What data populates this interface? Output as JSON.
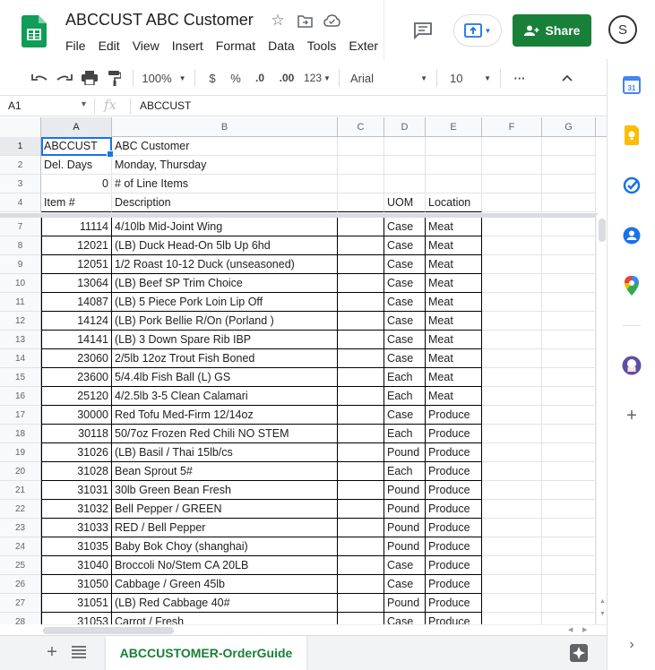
{
  "header": {
    "title": "ABCCUST ABC Customer",
    "menu": [
      "File",
      "Edit",
      "View",
      "Insert",
      "Format",
      "Data",
      "Tools",
      "Exter"
    ],
    "share_label": "Share",
    "avatar_letter": "S"
  },
  "toolbar": {
    "zoom": "100%",
    "currency": "$",
    "percent": "%",
    "decrease_decimal": ".0",
    "increase_decimal": ".00",
    "number_format": "123",
    "font": "Arial",
    "font_size": "10",
    "more": "···"
  },
  "formula_bar": {
    "cell_ref": "A1",
    "fx": "fx",
    "value": "ABCCUST"
  },
  "columns": [
    "A",
    "B",
    "C",
    "D",
    "E",
    "F",
    "G"
  ],
  "top_rows": [
    {
      "num": "1",
      "a": "ABCCUST",
      "b": "ABC Customer",
      "d": "",
      "e": ""
    },
    {
      "num": "2",
      "a": "Del. Days",
      "b": "Monday, Thursday",
      "d": "",
      "e": ""
    },
    {
      "num": "3",
      "a": "0",
      "b": "# of Line Items",
      "d": "",
      "e": ""
    },
    {
      "num": "4",
      "a": "Item #",
      "b": "Description",
      "d": "UOM",
      "e": "Location"
    }
  ],
  "rows": [
    {
      "num": "7",
      "a": "11114",
      "b": "4/10lb Mid-Joint Wing",
      "d": "Case",
      "e": "Meat"
    },
    {
      "num": "8",
      "a": "12021",
      "b": "(LB) Duck Head-On 5lb Up 6hd",
      "d": "Case",
      "e": "Meat"
    },
    {
      "num": "9",
      "a": "12051",
      "b": "1/2 Roast 10-12 Duck (unseasoned)",
      "d": "Case",
      "e": "Meat"
    },
    {
      "num": "10",
      "a": "13064",
      "b": "(LB) Beef SP Trim Choice",
      "d": "Case",
      "e": "Meat"
    },
    {
      "num": "11",
      "a": "14087",
      "b": "(LB) 5 Piece Pork Loin Lip Off",
      "d": "Case",
      "e": "Meat"
    },
    {
      "num": "12",
      "a": "14124",
      "b": "(LB) Pork Bellie R/On (Porland )",
      "d": "Case",
      "e": "Meat"
    },
    {
      "num": "13",
      "a": "14141",
      "b": "(LB) 3 Down Spare Rib IBP",
      "d": "Case",
      "e": "Meat"
    },
    {
      "num": "14",
      "a": "23060",
      "b": "2/5lb 12oz Trout Fish Boned",
      "d": "Case",
      "e": "Meat"
    },
    {
      "num": "15",
      "a": "23600",
      "b": "5/4.4lb Fish Ball (L) GS",
      "d": "Each",
      "e": "Meat"
    },
    {
      "num": "16",
      "a": "25120",
      "b": "4/2.5lb 3-5 Clean Calamari",
      "d": "Each",
      "e": "Meat"
    },
    {
      "num": "17",
      "a": "30000",
      "b": "Red Tofu Med-Firm 12/14oz",
      "d": "Case",
      "e": "Produce"
    },
    {
      "num": "18",
      "a": "30118",
      "b": "50/7oz Frozen Red Chili NO STEM",
      "d": "Each",
      "e": "Produce"
    },
    {
      "num": "19",
      "a": "31026",
      "b": "(LB) Basil / Thai 15lb/cs",
      "d": "Pound",
      "e": "Produce"
    },
    {
      "num": "20",
      "a": "31028",
      "b": "Bean Sprout 5#",
      "d": "Each",
      "e": "Produce"
    },
    {
      "num": "21",
      "a": "31031",
      "b": "30lb Green Bean Fresh",
      "d": "Pound",
      "e": "Produce"
    },
    {
      "num": "22",
      "a": "31032",
      "b": "Bell Pepper / GREEN",
      "d": "Pound",
      "e": "Produce"
    },
    {
      "num": "23",
      "a": "31033",
      "b": "RED / Bell Pepper",
      "d": "Pound",
      "e": "Produce"
    },
    {
      "num": "24",
      "a": "31035",
      "b": "Baby Bok Choy (shanghai)",
      "d": "Pound",
      "e": "Produce"
    },
    {
      "num": "25",
      "a": "31040",
      "b": "Broccoli No/Stem CA 20LB",
      "d": "Case",
      "e": "Produce"
    },
    {
      "num": "26",
      "a": "31050",
      "b": "Cabbage / Green 45lb",
      "d": "Case",
      "e": "Produce"
    },
    {
      "num": "27",
      "a": "31051",
      "b": "(LB) Red Cabbage 40#",
      "d": "Pound",
      "e": "Produce"
    },
    {
      "num": "28",
      "a": "31053",
      "b": "Carrot / Fresh",
      "d": "Case",
      "e": "Produce"
    }
  ],
  "sheet_tab": "ABCCUSTOMER-OrderGuide",
  "colors": {
    "share_green": "#188038",
    "selection_blue": "#1a73e8"
  }
}
